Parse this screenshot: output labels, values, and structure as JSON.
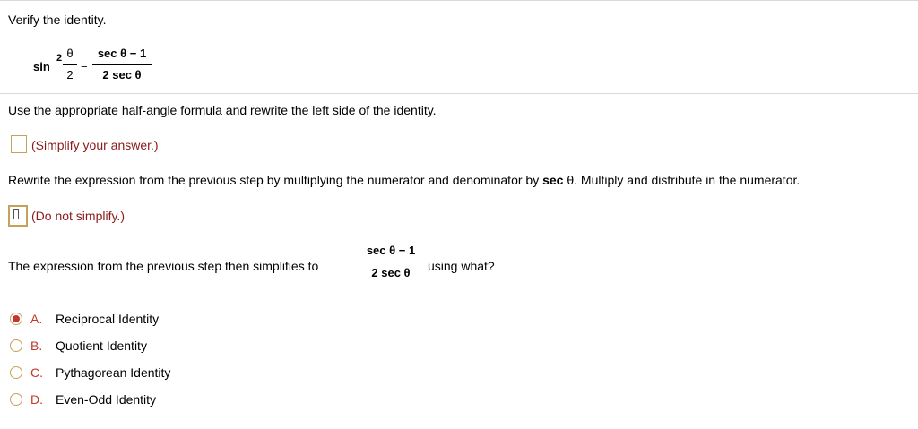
{
  "question": {
    "prompt": "Verify the identity.",
    "identity": {
      "lhs_func": "sin",
      "lhs_exp": "2",
      "lhs_num": "θ",
      "lhs_den": "2",
      "equals": "=",
      "rhs_num": "sec θ − 1",
      "rhs_den": "2 sec θ"
    }
  },
  "step1": {
    "instruction": "Use the appropriate half-angle formula and rewrite the left side of the identity.",
    "hint": "(Simplify your answer.)"
  },
  "step2": {
    "instruction_pre": "Rewrite the expression from the previous step by multiplying the numerator and denominator by ",
    "instruction_bold": "sec",
    "instruction_post": " θ. Multiply and distribute in the numerator.",
    "hint": "(Do not simplify.)"
  },
  "step3": {
    "text_pre": "The expression from the previous step then simplifies to",
    "frac_num": "sec θ − 1",
    "frac_den": "2 sec θ",
    "text_post": "using what?"
  },
  "options": [
    {
      "letter": "A.",
      "label": "Reciprocal Identity",
      "selected": true
    },
    {
      "letter": "B.",
      "label": "Quotient Identity",
      "selected": false
    },
    {
      "letter": "C.",
      "label": "Pythagorean Identity",
      "selected": false
    },
    {
      "letter": "D.",
      "label": "Even-Odd Identity",
      "selected": false
    }
  ],
  "colors": {
    "accent_red": "#c0392b",
    "hint_red": "#8b1a1a",
    "box_border": "#c6a15a"
  }
}
